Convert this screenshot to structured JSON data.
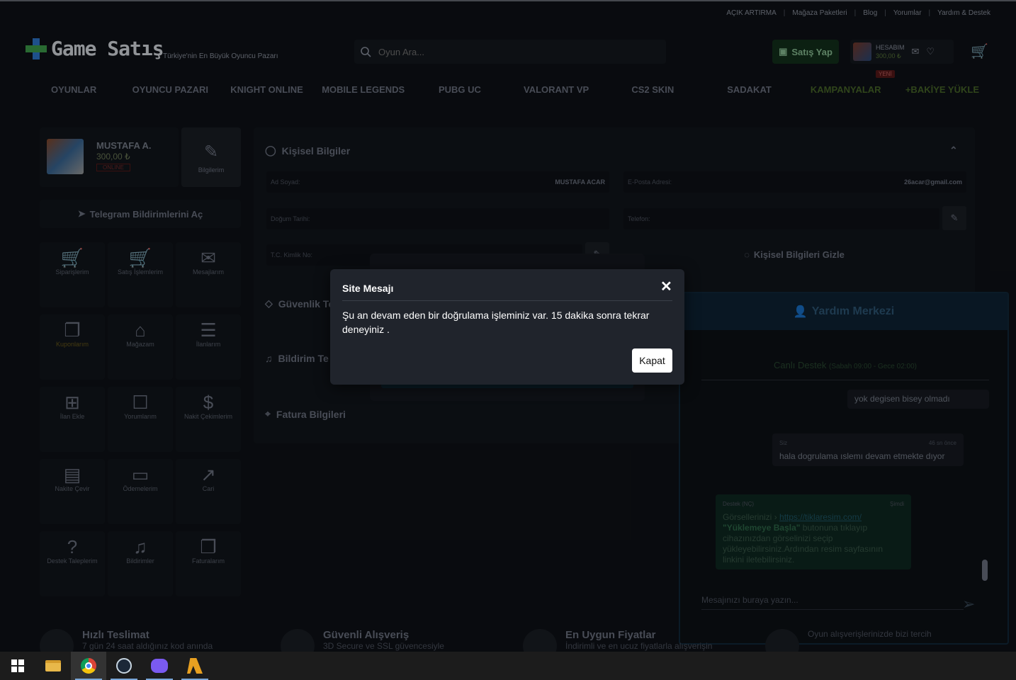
{
  "top_links": [
    "AÇIK ARTIRMA",
    "Mağaza Paketleri",
    "Blog",
    "Yorumlar",
    "Yardım & Destek"
  ],
  "logo": {
    "text": "Game Satış",
    "tagline": "Türkiye'nin En Büyük Oyuncu Pazarı"
  },
  "search": {
    "placeholder": "Oyun Ara..."
  },
  "header": {
    "sell_label": "Satış Yap",
    "account_label": "HESABIM",
    "account_balance": "300,00 ₺",
    "new_badge": "YENİ"
  },
  "nav": [
    "OYUNLAR",
    "OYUNCU PAZARI",
    "KNIGHT ONLINE",
    "MOBILE LEGENDS",
    "PUBG UC",
    "VALORANT VP",
    "CS2 SKIN",
    "SADAKAT",
    "KAMPANYALAR",
    "+BAKİYE YÜKLE"
  ],
  "profile": {
    "name": "MUSTAFA A.",
    "balance": "300,00 ₺",
    "status": "ONLINE",
    "edit_label": "Bilgilerim",
    "telegram_label": "Telegram Bildirimlerini Aç"
  },
  "menu": [
    {
      "label": "Siparişlerim",
      "icon": "cart-icon"
    },
    {
      "label": "Satış İşlemlerim",
      "icon": "cart-up-icon"
    },
    {
      "label": "Mesajlarım",
      "icon": "mail-icon"
    },
    {
      "label": "Kuponlarım",
      "icon": "coupon-icon"
    },
    {
      "label": "Mağazam",
      "icon": "store-icon"
    },
    {
      "label": "İlanlarım",
      "icon": "clipboard-icon"
    },
    {
      "label": "İlan Ekle",
      "icon": "add-listing-icon"
    },
    {
      "label": "Yorumlarım",
      "icon": "comment-icon"
    },
    {
      "label": "Nakit Çekimlerim",
      "icon": "cash-icon"
    },
    {
      "label": "Nakite Çevir",
      "icon": "wallet-icon"
    },
    {
      "label": "Ödemelerim",
      "icon": "card-icon"
    },
    {
      "label": "Cari",
      "icon": "chart-icon"
    },
    {
      "label": "Destek Taleplerim",
      "icon": "help-icon"
    },
    {
      "label": "Bildirimler",
      "icon": "bell-icon"
    },
    {
      "label": "Faturalarım",
      "icon": "invoice-icon"
    }
  ],
  "main": {
    "personal_title": "Kişisel Bilgiler",
    "name_label": "Ad Soyad:",
    "name_value": "MUSTAFA ACAR",
    "email_label": "E-Posta Adresi:",
    "email_value": "26acar@gmail.com",
    "birth_label": "Doğum Tarihi:",
    "phone_label": "Telefon:",
    "tc_label": "T.C. Kimlik No:",
    "hide_label": "Kişisel Bilgileri Gizle",
    "security_title": "Güvenlik Te",
    "notify_title": "Bildirim Te",
    "invoice_title": "Fatura Bilgileri"
  },
  "help": {
    "title": "Yardım Merkezi",
    "live_label": "Canlı Destek",
    "hours": "(Sabah 09:00 - Gece 02:00)",
    "msg1": "yok degisen bisey olmadı",
    "msg2_sender": "Siz",
    "msg2_time": "46 sn önce",
    "msg2_text": "hala dogrulama ıslemı devam etmekte dıyor",
    "msg3_sender": "Destek (NÇ)",
    "msg3_time": "Şimdi",
    "msg3_pre": "Görsellerinizi",
    "msg3_link": "https://tiklaresim.com/",
    "msg3_bold": "\"Yüklemeye Başla\"",
    "msg3_text": "butonuna tıklayıp cihazınızdan görselinizi seçip yükleyebilirsiniz.Ardından resim sayfasının linkini iletebilirsiniz.",
    "input_placeholder": "Mesajınızı buraya yazın..."
  },
  "features": [
    {
      "title": "Hızlı Teslimat",
      "desc": "7 gün 24 saat aldığınız kod anında"
    },
    {
      "title": "Güvenli Alışveriş",
      "desc": "3D Secure ve SSL güvencesiyle"
    },
    {
      "title": "En Uygun Fiyatlar",
      "desc": "İndirimli ve en ucuz fiyatlarla alışverişin"
    },
    {
      "title": "",
      "desc": "Oyun alışverişlerinizde bizi tercih"
    }
  ],
  "modal": {
    "title": "Site Mesajı",
    "body": "Şu an devam eden bir doğrulama işleminiz var. 15 dakika sonra tekrar deneyiniz .",
    "close_label": "Kapat"
  },
  "colors": {
    "modal_bg": "#20242c",
    "accent_green": "#13321c",
    "help_blue": "#0f2436"
  }
}
